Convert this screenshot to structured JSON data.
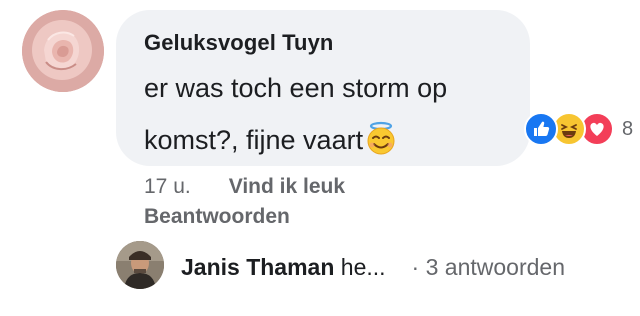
{
  "comment": {
    "author": "Geluksvogel Tuyn",
    "text": "er was toch een storm op komst?, fijne vaart",
    "text_emoji": "smiling-face-with-halo",
    "avatar": "rose-photo"
  },
  "reactions": {
    "types": [
      "like",
      "haha",
      "love"
    ],
    "count": "8"
  },
  "meta": {
    "time": "17 u.",
    "like_label": "Vind ik leuk",
    "reply_label": "Beantwoorden"
  },
  "reply_preview": {
    "author": "Janis Thaman",
    "snippet": "he...",
    "separator": "·",
    "count_label": "3 antwoorden"
  },
  "colors": {
    "bubble": "#f0f2f5",
    "secondary_text": "#65676b",
    "like": "#1877f2",
    "haha": "#f7c531",
    "love": "#f33e58"
  }
}
